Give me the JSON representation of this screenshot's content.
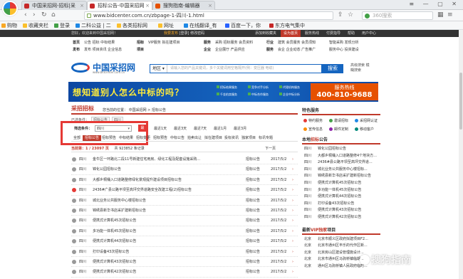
{
  "browser": {
    "tabs": [
      {
        "label": "中国采招网-招标|采"
      },
      {
        "label": "招标公告-中国采招网"
      },
      {
        "label": "搜狗指南-编辑器"
      }
    ],
    "url": "www.bidcenter.com.cn/zbpage-1-四川-1.html",
    "search_placeholder": "360搜索",
    "bookmarks": [
      "购物",
      "收藏夹栏",
      "登录",
      "二科公益 | 二",
      "各类招标网",
      "网址",
      "在线翻译_有",
      "百度一下，你",
      "东方电气集中"
    ]
  },
  "site": {
    "topbar": {
      "welcome": "您好，欢迎来到中国采招网！",
      "links": [
        "我要发布",
        "[登录]",
        "修改密码"
      ],
      "right": [
        "添加到收藏夹",
        "设为首页",
        "服务热线",
        "付费指导",
        "帮助",
        "用户中心"
      ]
    },
    "nav": {
      "col1_title": "首页",
      "col1_a": "公告 招标 中标结果",
      "col1_b": "发布 项目资讯 企业信息",
      "col2_title": "招标",
      "col2_a": "VIP服务 拟在建项目",
      "col3_title": "服务",
      "col3_a": "采购 招标服务 会员资料",
      "col3_b": "企业展厅 产品供应",
      "col4_title": "行业",
      "col4_a": "建筑 会员服务 会员须知",
      "col4_b": "会企 企业动态 广告推广",
      "col5_a": "智能采购 发现分析",
      "col5_b": "服务中心 投资建设"
    },
    "logo": {
      "title": "中国采招网",
      "url": "www.bidcenter.com.cn"
    },
    "search": {
      "region": "地区",
      "placeholder": "请输入您的产品关键词，多个关键词用空格隔开(例：变压器 电缆)",
      "button": "搜索",
      "advanced": "高级搜索 模糊搜索"
    },
    "banner": {
      "headline": "想知道别人怎么中标的吗？",
      "points": [
        "招标结果服务",
        "千金拍卖服务",
        "竞争对手分析",
        "中标合作服务",
        "代理机构服务",
        "企业中标分析"
      ],
      "hotline_label": "服务热线",
      "hotline": "400-810-9688"
    },
    "breadcrumb": {
      "logo": "采招招标",
      "path": "您当前的位置： 中国采招网 > 招标公告"
    },
    "selected": {
      "label": "已选条件：",
      "tags": [
        "招标公告",
        "四川"
      ]
    },
    "filter": {
      "label": "筛选条件：",
      "region_value": "四川",
      "time_tag": "最",
      "time_options": [
        "最近1天",
        "最近3天",
        "最近7天",
        "最近1月",
        "最近3月"
      ]
    },
    "categories": [
      "全部",
      "招标公告",
      "招标预告",
      "中标结果",
      "招标变更",
      "招标预告",
      "中标公告",
      "拍卖出让",
      "拟在建项目",
      "投标资讯",
      "独家项目",
      "标讯专题"
    ],
    "pager": {
      "current": "当前第：1 / 23097 页",
      "total": "共 923852 条记录",
      "next": "下一页"
    },
    "rows": [
      {
        "region": "四川",
        "title": "金牛区一环路北二段11号新建住宅用房、绿化工程及配套设施采购...",
        "type": "招标公告",
        "date": "2017/5/2",
        "hot": false
      },
      {
        "region": "四川",
        "title": "锦化公园招标公告",
        "type": "招标公告",
        "date": "2017/5/2",
        "hot": false
      },
      {
        "region": "四川",
        "title": "大都乡桐桶入口道路整修绿化景观提升建设项目招标公告",
        "type": "招标公告",
        "date": "2017/5/2",
        "hot": false
      },
      {
        "region": "四川",
        "title": "2436#广县公路平坝至高坪交界道路安全改建工程(2)招标公告",
        "type": "招标公告",
        "date": "2017/5/2",
        "hot": true
      },
      {
        "region": "四川",
        "title": "城北业务公共服务中心楼招标公告",
        "type": "招标公告",
        "date": "2017/5/2",
        "hot": false
      },
      {
        "region": "四川",
        "title": "锦绣县新华书店采扩建新招标公告",
        "type": "招标公告",
        "date": "2017/5/2",
        "hot": false
      },
      {
        "region": "四川",
        "title": "便携式计算机45次招标公告",
        "type": "招标公告",
        "date": "2017/5/2",
        "hot": false
      },
      {
        "region": "四川",
        "title": "多功能一体机45次招标公告",
        "type": "招标公告",
        "date": "2017/5/2",
        "hot": false
      },
      {
        "region": "四川",
        "title": "便携式计算机44次招标公告",
        "type": "招标公告",
        "date": "2017/5/2",
        "hot": false
      },
      {
        "region": "四川",
        "title": "打印设备43次招标公告",
        "type": "招标公告",
        "date": "2017/5/2",
        "hot": false
      },
      {
        "region": "四川",
        "title": "便携式计算机43次招标公告",
        "type": "招标公告",
        "date": "2017/5/2",
        "hot": false
      },
      {
        "region": "四川",
        "title": "便携式计算机42次招标公告",
        "type": "招标公告",
        "date": "2017/5/2",
        "hot": false
      }
    ],
    "sidebar": {
      "service_title": "特色服务",
      "services": [
        "特约服务",
        "邀请招标",
        "采招网认证",
        "宣传信息",
        "邮件定制",
        "移动客户"
      ],
      "local_title_pre": "本地",
      "local_title_em": "招标",
      "local_title_post": "公告",
      "local": [
        {
          "region": "四川",
          "title": "锦化公园招标公告"
        },
        {
          "region": "四川",
          "title": "大都乡桐桶入口道路整修4个地块方..."
        },
        {
          "region": "四川",
          "title": "2436#县公路平坝至高坪交界道..."
        },
        {
          "region": "四川",
          "title": "城北业务公共服务中心楼招标..."
        },
        {
          "region": "四川",
          "title": "锦绣县新华书店采扩建新招标公告"
        },
        {
          "region": "四川",
          "title": "便携式计算机45次招标公告"
        },
        {
          "region": "四川",
          "title": "多功能一体机45次招标公告"
        },
        {
          "region": "四川",
          "title": "便携式计算机44次招标公告"
        },
        {
          "region": "四川",
          "title": "打印设备43次招标公告"
        },
        {
          "region": "四川",
          "title": "便携式计算机43次招标公告"
        },
        {
          "region": "四川",
          "title": "便携式计算机42次招标公告"
        }
      ],
      "vip_title_pre": "最新",
      "vip_title_em": "VIP独家",
      "vip_title_post": "项目",
      "vip": [
        {
          "region": "北京",
          "title": "北京市顺义区政府拟建项目F2..."
        },
        {
          "region": "北京",
          "title": "北京市通州区丰乐的代作区新..."
        },
        {
          "region": "北京",
          "title": "北京房山区建设管理施设计..."
        },
        {
          "region": "北京",
          "title": "北京市通州区马驹桥镇临期..."
        },
        {
          "region": "北京",
          "title": "通州区马驹桥镇人民政府临时..."
        }
      ]
    },
    "watermark": "搜狗指南"
  }
}
